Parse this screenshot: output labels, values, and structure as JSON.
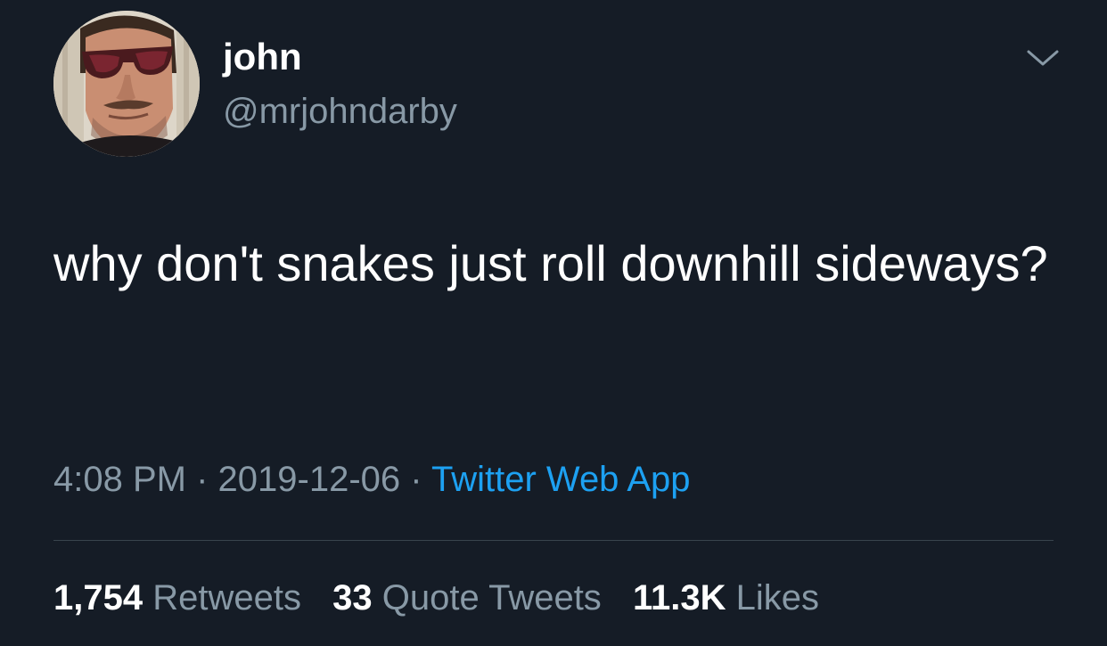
{
  "user": {
    "display_name": "john",
    "handle": "@mrjohndarby"
  },
  "tweet": {
    "text": "why don't snakes just roll downhill sideways?",
    "time": "4:08 PM",
    "date": "2019-12-06",
    "separator": "·",
    "source": "Twitter Web App"
  },
  "stats": {
    "retweets_count": "1,754",
    "retweets_label": "Retweets",
    "quotes_count": "33",
    "quotes_label": "Quote Tweets",
    "likes_count": "11.3K",
    "likes_label": "Likes"
  },
  "icons": {
    "menu": "chevron-down-icon"
  },
  "colors": {
    "background": "#151c26",
    "primary_text": "#ffffff",
    "secondary_text": "#8899a6",
    "link": "#1da1f2",
    "divider": "#38444d"
  }
}
